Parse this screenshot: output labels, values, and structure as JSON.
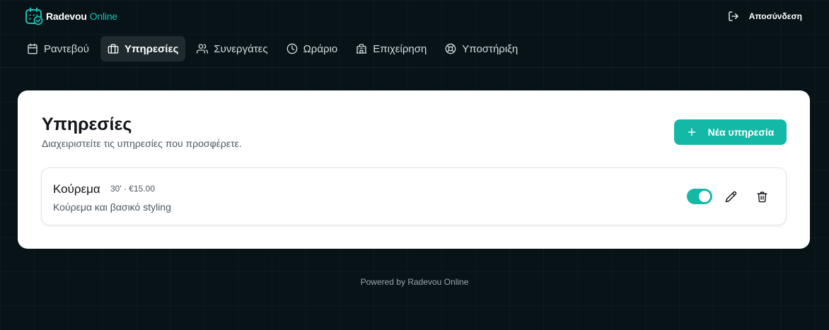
{
  "brand": {
    "name": "Radevou",
    "accent": "Online",
    "logo_icon": "calendar-check-icon",
    "accent_color": "#17c3b2"
  },
  "header": {
    "logout_label": "Αποσύνδεση",
    "logout_icon": "log-out-icon"
  },
  "nav": {
    "items": [
      {
        "label": "Ραντεβού",
        "icon": "calendar-icon",
        "active": false
      },
      {
        "label": "Υπηρεσίες",
        "icon": "briefcase-icon",
        "active": true
      },
      {
        "label": "Συνεργάτες",
        "icon": "users-icon",
        "active": false
      },
      {
        "label": "Ωράριο",
        "icon": "clock-icon",
        "active": false
      },
      {
        "label": "Επιχείρηση",
        "icon": "building-icon",
        "active": false
      },
      {
        "label": "Υποστήριξη",
        "icon": "life-buoy-icon",
        "active": false
      }
    ]
  },
  "main": {
    "title": "Υπηρεσίες",
    "subtitle": "Διαχειριστείτε τις υπηρεσίες που προσφέρετε.",
    "new_button_label": "Νέα υπηρεσία",
    "accent_color": "#14b8a6",
    "services": [
      {
        "name": "Κούρεμα",
        "meta": "30' · €15.00",
        "description": "Κούρεμα και βασικό styling",
        "enabled": true
      }
    ]
  },
  "footer": {
    "text": "Powered by Radevou Online"
  }
}
